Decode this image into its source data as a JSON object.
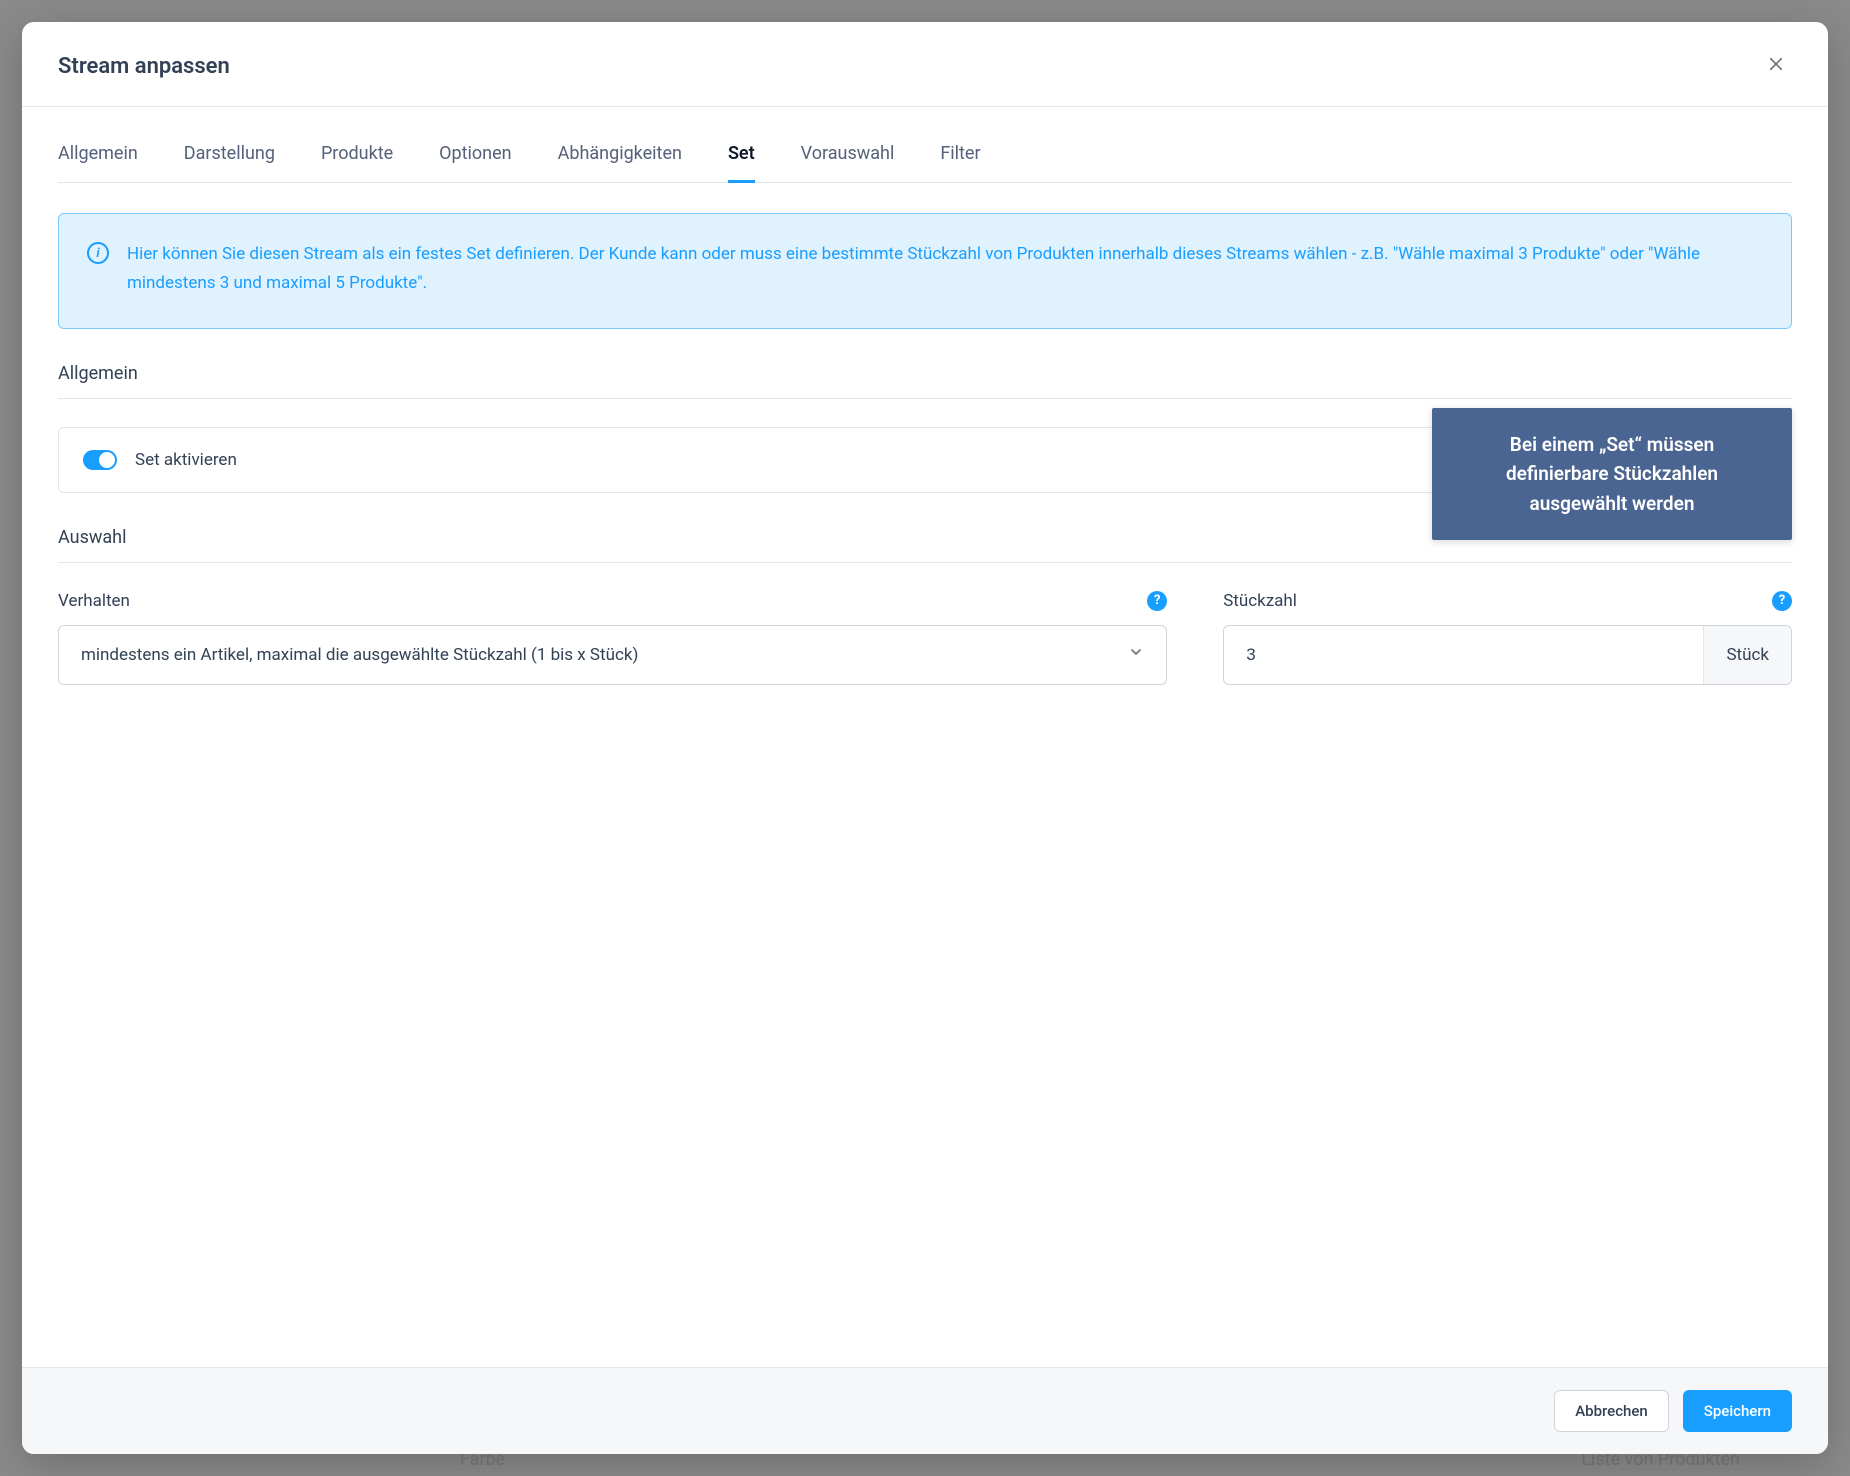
{
  "modal": {
    "title": "Stream anpassen"
  },
  "tabs": [
    {
      "label": "Allgemein"
    },
    {
      "label": "Darstellung"
    },
    {
      "label": "Produkte"
    },
    {
      "label": "Optionen"
    },
    {
      "label": "Abhängigkeiten"
    },
    {
      "label": "Set"
    },
    {
      "label": "Vorauswahl"
    },
    {
      "label": "Filter"
    }
  ],
  "active_tab_index": 5,
  "info": {
    "text": "Hier können Sie diesen Stream als ein festes Set definieren. Der Kunde kann oder muss eine bestimmte Stückzahl von Produkten innerhalb dieses Streams wählen - z.B. \"Wähle maximal 3 Produkte\" oder \"Wähle mindestens 3 und maximal 5 Produkte\"."
  },
  "sections": {
    "general_title": "Allgemein",
    "toggle_label": "Set aktivieren",
    "toggle_on": true,
    "selection_title": "Auswahl",
    "behavior": {
      "label": "Verhalten",
      "value": "mindestens ein Artikel, maximal die ausgewählte Stückzahl (1 bis x Stück)"
    },
    "quantity": {
      "label": "Stückzahl",
      "value": "3",
      "suffix": "Stück"
    }
  },
  "callout": {
    "text": "Bei einem „Set“ müssen definierbare Stückzahlen ausgewählt werden"
  },
  "footer": {
    "cancel": "Abbrechen",
    "save": "Speichern"
  },
  "background": {
    "hint1": "Farbe",
    "hint2": "Liste von Produkten"
  },
  "colors": {
    "accent": "#189eff",
    "callout_bg": "#4a6591"
  }
}
